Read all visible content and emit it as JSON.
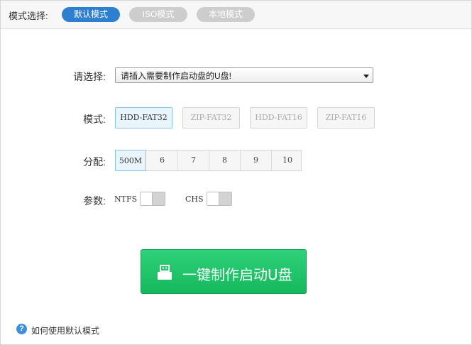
{
  "top": {
    "label": "模式选择:",
    "modes": [
      {
        "label": "默认模式",
        "active": true
      },
      {
        "label": "ISO模式",
        "active": false
      },
      {
        "label": "本地模式",
        "active": false
      }
    ]
  },
  "select": {
    "label": "请选择:",
    "value": "请插入需要制作启动盘的U盘!"
  },
  "format": {
    "label": "模式:",
    "options": [
      "HDD-FAT32",
      "ZIP-FAT32",
      "HDD-FAT16",
      "ZIP-FAT16"
    ],
    "selected": "HDD-FAT32"
  },
  "partition": {
    "label": "分配:",
    "options": [
      "500M",
      "6",
      "7",
      "8",
      "9",
      "10"
    ],
    "selected": "500M"
  },
  "params": {
    "label": "参数:",
    "ntfs_label": "NTFS",
    "ntfs_on": false,
    "chs_label": "CHS",
    "chs_on": false
  },
  "make_button": {
    "label": "一键制作启动U盘",
    "icon": "usb-drive-icon"
  },
  "help": {
    "icon": "question-icon",
    "text": "如何使用默认模式"
  },
  "colors": {
    "accent": "#2f7fd0",
    "primary_button": "#15b85c",
    "selected_border": "#8bc4e6"
  }
}
